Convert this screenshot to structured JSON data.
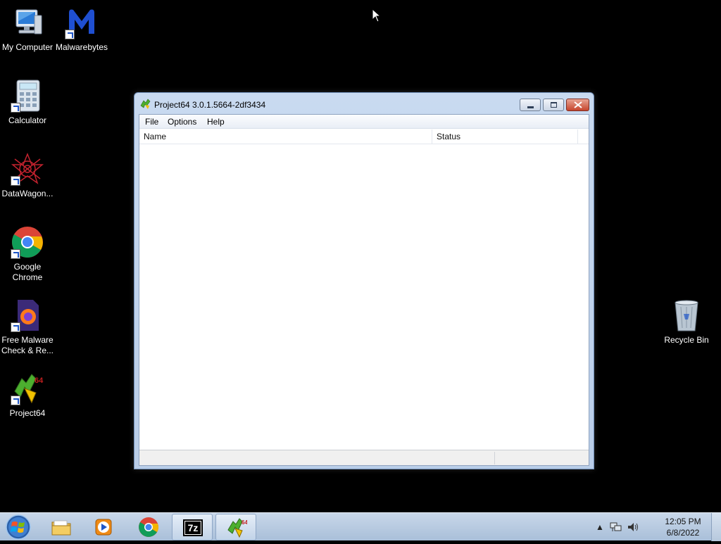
{
  "desktop": {
    "icons": [
      {
        "label": "My Computer",
        "icon": "computer-icon"
      },
      {
        "label": "Malwarebytes",
        "icon": "malwarebytes-icon"
      },
      {
        "label": "Calculator",
        "icon": "calculator-icon"
      },
      {
        "label": "DataWagon...",
        "icon": "datawagon-icon"
      },
      {
        "label": "Google Chrome",
        "icon": "chrome-icon"
      },
      {
        "label": "Free Malware Check & Re...",
        "icon": "firefox-document-icon"
      },
      {
        "label": "Project64",
        "icon": "project64-icon"
      },
      {
        "label": "Recycle Bin",
        "icon": "recycle-bin-icon"
      }
    ]
  },
  "window": {
    "title": "Project64 3.0.1.5664-2df3434",
    "menu": [
      "File",
      "Options",
      "Help"
    ],
    "columns": [
      "Name",
      "Status"
    ],
    "rows": [],
    "status": [
      "",
      ""
    ]
  },
  "taskbar": {
    "items": [
      {
        "name": "explorer",
        "icon": "folder-icon",
        "active": false
      },
      {
        "name": "media-player",
        "icon": "media-player-icon",
        "active": false
      },
      {
        "name": "chrome",
        "icon": "chrome-icon",
        "active": false
      },
      {
        "name": "7zip",
        "icon": "sevenzip-icon",
        "active": true
      },
      {
        "name": "project64",
        "icon": "project64-icon",
        "active": true
      }
    ],
    "clock": {
      "time": "12:05 PM",
      "date": "6/8/2022"
    }
  },
  "colors": {
    "taskbar": "#b9cde4",
    "window_frame": "#c9daf0",
    "close_button": "#c6452d",
    "desktop": "#000000"
  }
}
